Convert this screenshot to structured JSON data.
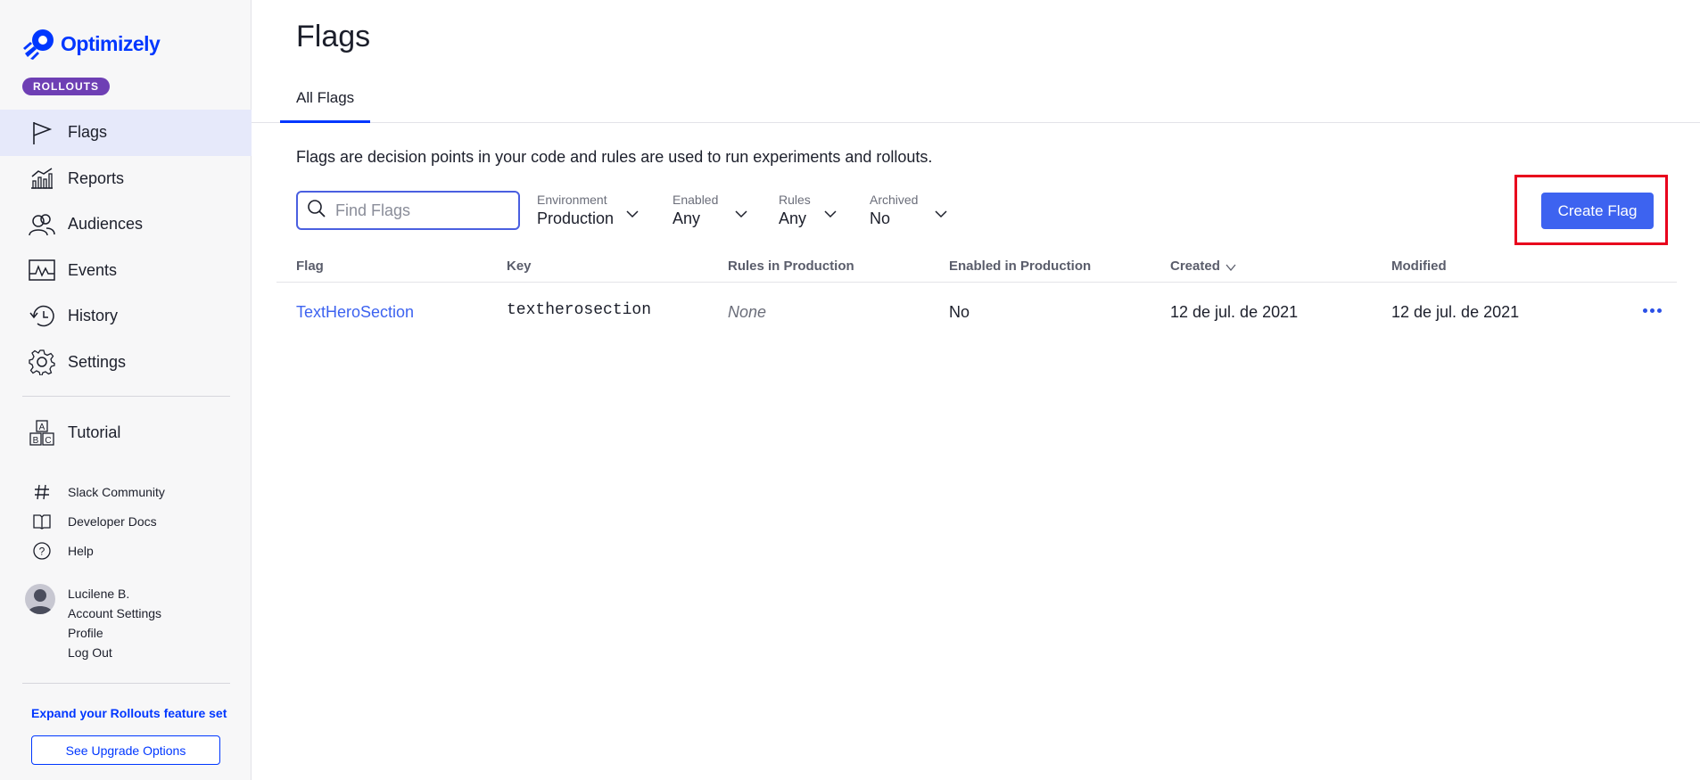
{
  "brand": {
    "name": "Optimizely",
    "badge": "ROLLOUTS",
    "accent": "#0037ff"
  },
  "sidebar": {
    "items": [
      {
        "label": "Flags",
        "icon": "flag-icon",
        "active": true
      },
      {
        "label": "Reports",
        "icon": "reports-icon"
      },
      {
        "label": "Audiences",
        "icon": "audiences-icon"
      },
      {
        "label": "Events",
        "icon": "events-icon"
      },
      {
        "label": "History",
        "icon": "history-icon"
      },
      {
        "label": "Settings",
        "icon": "gear-icon"
      }
    ],
    "tutorial": {
      "label": "Tutorial",
      "icon": "abc-blocks-icon"
    },
    "links": [
      {
        "label": "Slack Community",
        "icon": "hash-icon"
      },
      {
        "label": "Developer Docs",
        "icon": "book-icon"
      },
      {
        "label": "Help",
        "icon": "help-icon"
      }
    ],
    "user": {
      "name": "Lucilene B.",
      "account_settings": "Account Settings",
      "profile": "Profile",
      "logout": "Log Out"
    },
    "expand_text": "Expand your Rollouts feature set",
    "upgrade_button": "See Upgrade Options"
  },
  "main": {
    "title": "Flags",
    "tab": "All Flags",
    "description": "Flags are decision points in your code and rules are used to run experiments and rollouts.",
    "search": {
      "placeholder": "Find Flags",
      "value": ""
    },
    "filters": [
      {
        "label": "Environment",
        "value": "Production"
      },
      {
        "label": "Enabled",
        "value": "Any"
      },
      {
        "label": "Rules",
        "value": "Any"
      },
      {
        "label": "Archived",
        "value": "No"
      }
    ],
    "create_button": "Create Flag",
    "table": {
      "headers": [
        "Flag",
        "Key",
        "Rules in Production",
        "Enabled in Production",
        "Created",
        "Modified"
      ],
      "rows": [
        {
          "flag": "TextHeroSection",
          "key": "textherosection",
          "rules": "None",
          "enabled": "No",
          "created": "12 de jul. de 2021",
          "modified": "12 de jul. de 2021"
        }
      ]
    }
  }
}
